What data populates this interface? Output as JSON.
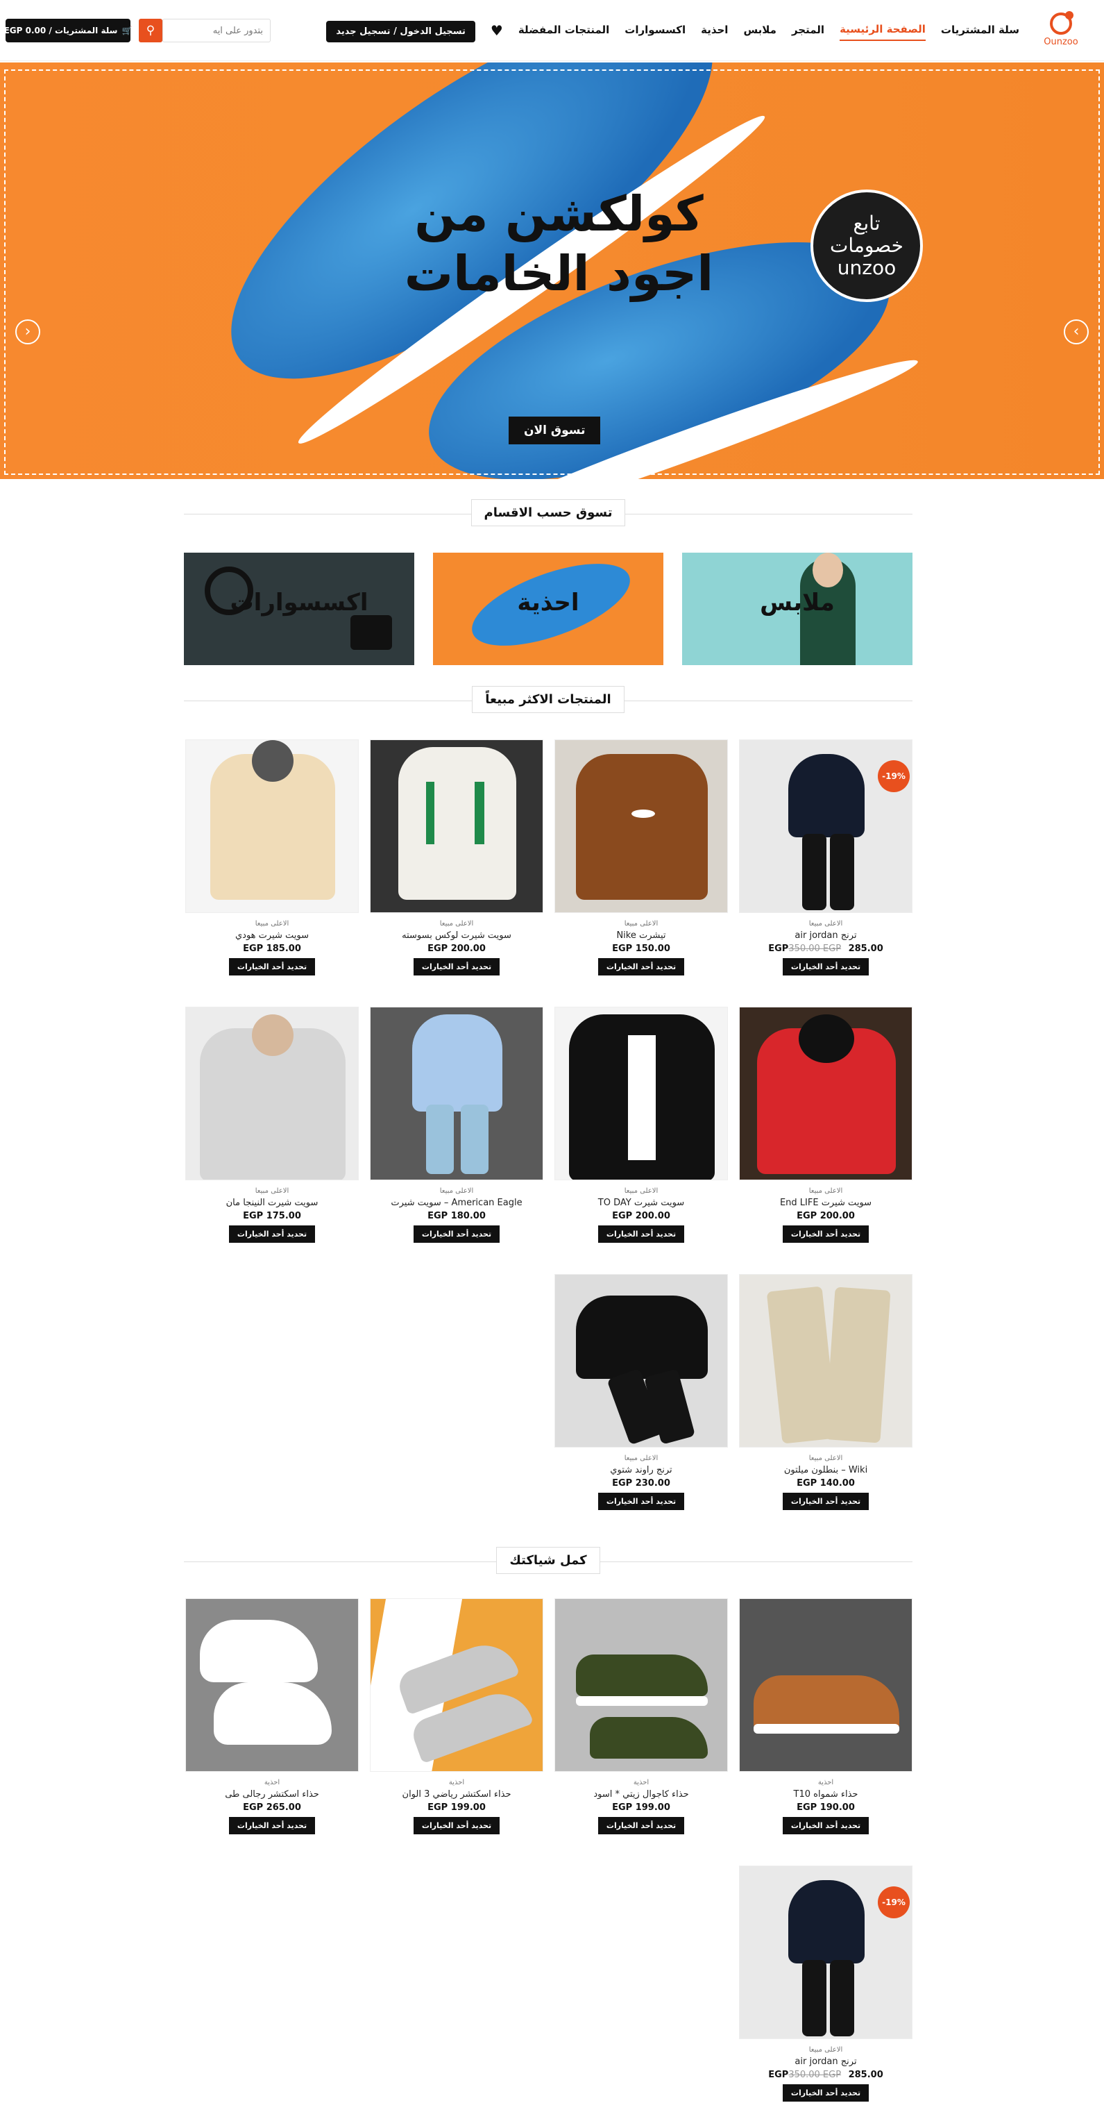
{
  "header": {
    "logo_text": "Ounzoo",
    "nav": [
      "الصفحة الرئيسية",
      "المتجر",
      "ملابس",
      "احذية",
      "اكسسوارات",
      "المنتجات المفضلة"
    ],
    "cart_link": "سلة المشتريات",
    "login_label": "تسجيل الدخول / تسجيل جديد",
    "search_placeholder": "بتدور على ايه",
    "cart_button": "سلة المشتريات / 0.00 EGP"
  },
  "hero": {
    "title_line1": "كولكشن من",
    "title_line2": "اجود الخامات",
    "cta": "تسوق الان",
    "badge_line1": "تابع",
    "badge_line2": "خصومات",
    "badge_line3": "unzoo"
  },
  "sections": {
    "categories": "تسوق حسب الاقسام",
    "best_sellers": "المنتجات الاكثر مبيعاً",
    "complete_look": "كمل شياكتك"
  },
  "categories": [
    "ملابس",
    "احذية",
    "اكسسوارات"
  ],
  "best_sellers": [
    {
      "category": "الاعلى مبيعا",
      "name": "ترنج air jordan",
      "price": "285.00 EGP",
      "old_price": "350.00 EGP",
      "sale": "-19%"
    },
    {
      "category": "الاعلى مبيعا",
      "name": "تيشرت Nike",
      "price": "150.00 EGP"
    },
    {
      "category": "الاعلى مبيعا",
      "name": "سويت شيرت لوكس بسوسته",
      "price": "200.00 EGP"
    },
    {
      "category": "الاعلى مبيعا",
      "name": "سويت شيرت هودي",
      "price": "185.00 EGP"
    },
    {
      "category": "الاعلى مبيعا",
      "name": "سويت شيرت End LIFE",
      "price": "200.00 EGP"
    },
    {
      "category": "الاعلى مبيعا",
      "name": "سويت شيرت TO DAY",
      "price": "200.00 EGP"
    },
    {
      "category": "الاعلى مبيعا",
      "name": "American Eagle – سويت شيرت",
      "price": "180.00 EGP"
    },
    {
      "category": "الاعلى مبيعا",
      "name": "سويت شيرت النينجا مان",
      "price": "175.00 EGP"
    },
    {
      "category": "الاعلى مبيعا",
      "name": "Wiki – بنطلون ميلتون",
      "price": "140.00 EGP"
    },
    {
      "category": "الاعلى مبيعا",
      "name": "ترنج راوند شتوي",
      "price": "230.00 EGP"
    }
  ],
  "look": [
    {
      "category": "احذية",
      "name": "حذاء شمواه T10",
      "price": "190.00 EGP"
    },
    {
      "category": "احذية",
      "name": "حذاء كاجوال زيتي * اسود",
      "price": "199.00 EGP"
    },
    {
      "category": "احذية",
      "name": "حذاء اسكتشر رياضي 3 الوان",
      "price": "199.00 EGP"
    },
    {
      "category": "احذية",
      "name": "حذاء اسكتشر رجالى طى",
      "price": "265.00 EGP"
    },
    {
      "category": "الاعلى مبيعا",
      "name": "ترنج air jordan",
      "price": "285.00 EGP",
      "old_price": "350.00 EGP",
      "sale": "-19%"
    }
  ],
  "option_button": "تحديد أحد الخيارات",
  "colors": {
    "accent": "#e8501e",
    "hero_bg": "#f58a2e",
    "dark": "#111111"
  }
}
